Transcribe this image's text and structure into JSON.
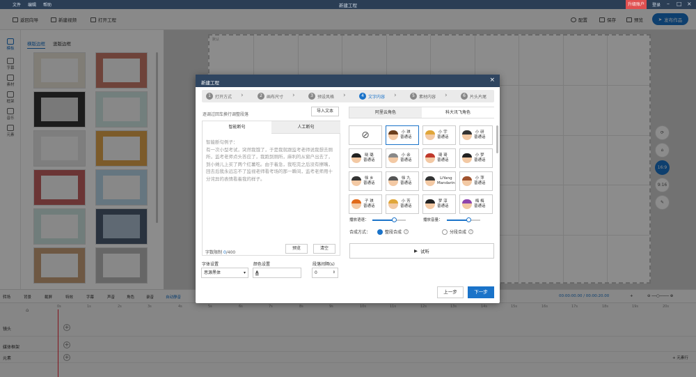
{
  "app": {
    "title": "新建工程",
    "upgrade": "升级账户",
    "login": "登录",
    "menu": [
      "文件",
      "编辑",
      "帮助"
    ]
  },
  "toolbar": {
    "back": "返回向导",
    "new_video": "新建视频",
    "open_project": "打开工程",
    "settings": "配置",
    "save": "保存",
    "preview": "预览",
    "publish": "发布作品"
  },
  "nav": [
    "模板",
    "字幕",
    "素材",
    "框架",
    "音乐",
    "元素"
  ],
  "panel": {
    "tabs": [
      "横版边框",
      "竖版边框"
    ]
  },
  "canvas": {
    "label": "默认"
  },
  "right_tools": [
    "16:9",
    "9:16"
  ],
  "timeline": {
    "tools": [
      "转场",
      "背景",
      "截屏",
      "特效",
      "字幕",
      "声音",
      "角色",
      "录音",
      "自动静音"
    ],
    "time": "00:00:00.00 / 00:00:20.00",
    "ruler": [
      "0s",
      "1s",
      "2s",
      "3s",
      "4s",
      "5s",
      "6s",
      "7s",
      "8s",
      "9s",
      "10s",
      "11s",
      "12s",
      "13s",
      "14s",
      "15s",
      "16s",
      "17s",
      "18s",
      "19s",
      "20s"
    ],
    "tracks": [
      "镜头",
      "媒体框架",
      "元素"
    ],
    "add_track": "元素行"
  },
  "dialog": {
    "title": "新建工程",
    "steps": [
      {
        "n": "1",
        "label": "打开方式"
      },
      {
        "n": "2",
        "label": "画布尺寸"
      },
      {
        "n": "3",
        "label": "预设风格"
      },
      {
        "n": "4",
        "label": "文字内容"
      },
      {
        "n": "5",
        "label": "素材内容"
      },
      {
        "n": "6",
        "label": "片头片尾"
      }
    ],
    "hint": "逐调过回车换行调整段落",
    "import_btn": "导入文本",
    "text_tabs": [
      "智能断句",
      "人工断句"
    ],
    "sample_title": "智能断句例子：",
    "sample_text": "有一次小型考试，突然我饿了，于是我就跟监考老师说我想去厕所，监考老师点头答应了，我跑到厕所，麻利的从窗户出去了，到小摊儿上买了两个红薯吃。由于着急，我吃完之后没有擦嘴，回去后我永远忘不了监视老师看考场的那一瞬间，监考老师用十分诧异的表情看着我的样子。",
    "word_limit_label": "字数限制",
    "word_count": "0",
    "word_max": "/400",
    "preview_btn": "预览",
    "clear_btn": "清空",
    "font_label": "字体设置",
    "font_value": "思源黑体",
    "color_label": "颜色设置",
    "color_swatch": "A",
    "spacing_label": "段落间隔(s)",
    "spacing_value": "0",
    "voice_tabs": [
      "阿里云角色",
      "科大讯飞角色"
    ],
    "voices": [
      {
        "name": "",
        "dialect": ""
      },
      {
        "name": "小 琪",
        "dialect": "普通话"
      },
      {
        "name": "小 宇",
        "dialect": "普通话"
      },
      {
        "name": "小 研",
        "dialect": "普通话"
      },
      {
        "name": "晓 璐",
        "dialect": "普通话"
      },
      {
        "name": "小 余",
        "dialect": "普通话"
      },
      {
        "name": "琦 琦",
        "dialect": "普通话"
      },
      {
        "name": "小 梦",
        "dialect": "普通话"
      },
      {
        "name": "徐 乡",
        "dialect": "普通话"
      },
      {
        "name": "徐 九",
        "dialect": "普通话"
      },
      {
        "name": "LiYang",
        "dialect": "Mandarin"
      },
      {
        "name": "小 萍",
        "dialect": "普通话"
      },
      {
        "name": "子 琪",
        "dialect": "普通话"
      },
      {
        "name": "小 芳",
        "dialect": "普通话"
      },
      {
        "name": "梦 淳",
        "dialect": "普通话"
      },
      {
        "name": "梅 梅",
        "dialect": "普通话"
      }
    ],
    "speed_label": "播放语速：",
    "volume_label": "播放音量：",
    "synth_label": "合成方式：",
    "synth_whole": "整段合成",
    "synth_split": "分段合成",
    "listen_btn": "试听",
    "prev_btn": "上一步",
    "next_btn": "下一步"
  }
}
